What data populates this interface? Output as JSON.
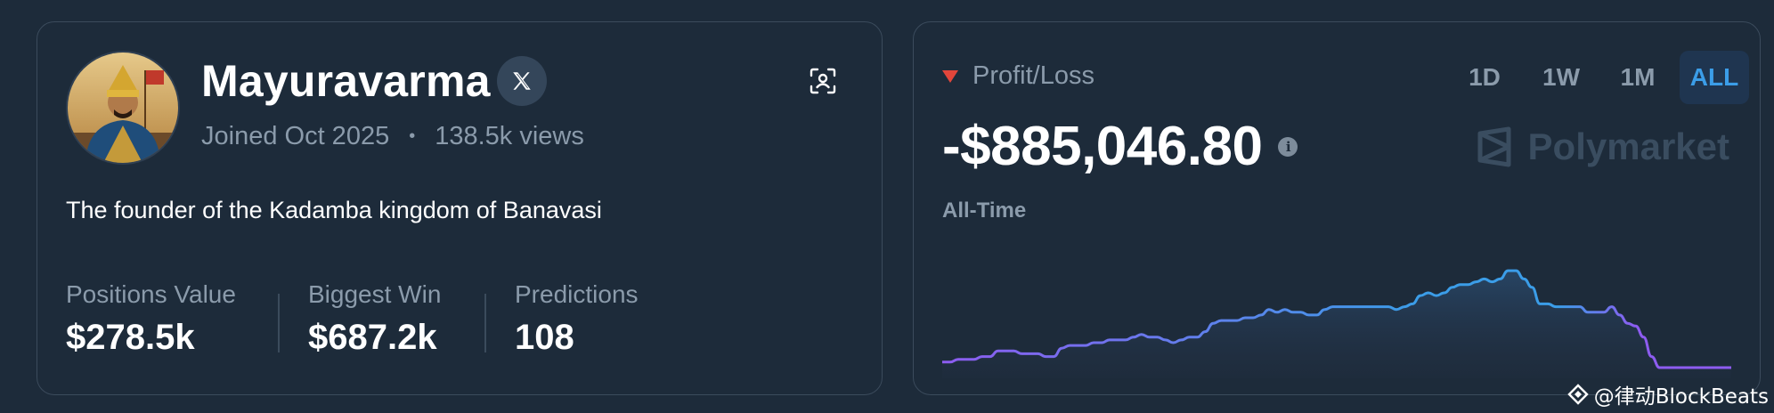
{
  "profile": {
    "name": "Mayuravarma",
    "joined": "Joined Oct 2025",
    "separator": "•",
    "views": "138.5k views",
    "bio": "The founder of the Kadamba kingdom of Banavasi",
    "social_icon": "x-logo-icon",
    "stats": [
      {
        "label": "Positions Value",
        "value": "$278.5k"
      },
      {
        "label": "Biggest Win",
        "value": "$687.2k"
      },
      {
        "label": "Predictions",
        "value": "108"
      }
    ]
  },
  "pnl": {
    "label": "Profit/Loss",
    "amount": "-$885,046.80",
    "period_label": "All-Time",
    "brand": "Polymarket",
    "ranges": [
      "1D",
      "1W",
      "1M",
      "ALL"
    ],
    "active_range": "ALL",
    "colors": {
      "negative": "#e2463b",
      "line_start": "#8d5cf0",
      "line_end": "#3b9de8",
      "active": "#3b9de8"
    }
  },
  "watermark": "@律动BlockBeats",
  "chart_data": {
    "type": "area",
    "values": [
      2,
      2,
      3,
      3,
      3,
      4,
      4,
      6,
      6,
      6,
      5,
      5,
      5,
      4,
      4,
      7,
      8,
      8,
      8,
      9,
      9,
      10,
      10,
      10,
      11,
      12,
      11,
      11,
      10,
      9,
      10,
      11,
      11,
      13,
      16,
      17,
      17,
      17,
      18,
      18,
      19,
      21,
      20,
      21,
      20,
      20,
      19,
      19,
      21,
      22,
      22,
      22,
      22,
      22,
      22,
      22,
      22,
      21,
      22,
      23,
      26,
      27,
      26,
      27,
      29,
      30,
      30,
      31,
      32,
      31,
      32,
      35,
      35,
      32,
      29,
      23,
      23,
      22,
      22,
      22,
      22,
      20,
      20,
      20,
      22,
      19,
      16,
      15,
      11,
      4,
      0,
      0,
      0,
      0,
      0,
      0,
      0,
      0,
      0,
      0
    ],
    "ylim": [
      0,
      36
    ]
  }
}
